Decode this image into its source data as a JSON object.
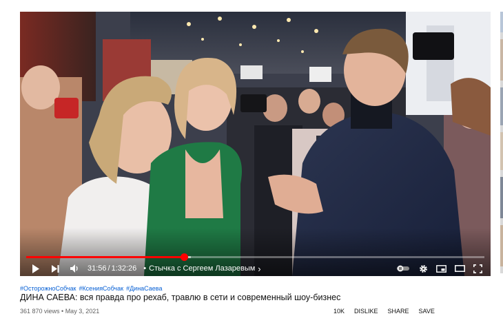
{
  "player": {
    "current_time": "31:56",
    "duration": "1:32:26",
    "time_separator": "/",
    "chapter_separator": "•",
    "chapter": "Стычка с Сергеем Лазаревым",
    "chapter_arrow": "›",
    "progress_fraction": 0.345,
    "buffered_fraction": 0.36,
    "icons": [
      "play-icon",
      "next-icon",
      "volume-icon",
      "autoplay-toggle-icon",
      "settings-gear-icon",
      "miniplayer-icon",
      "theater-mode-icon",
      "fullscreen-icon"
    ],
    "accent_color": "#ff0000"
  },
  "video": {
    "hashtags": [
      "#ОсторожноСобчак",
      "#КсенияСобчак",
      "#ДинаСаева"
    ],
    "title": "ДИНА САЕВА: вся правда про рехаб, травлю в сети и современный шоу-бизнес",
    "views_date": "361 870 views • May 3, 2021",
    "actions": [
      "10K",
      "DISLIKE",
      "SHARE",
      "SAVE"
    ],
    "link_color": "#065fd4"
  }
}
